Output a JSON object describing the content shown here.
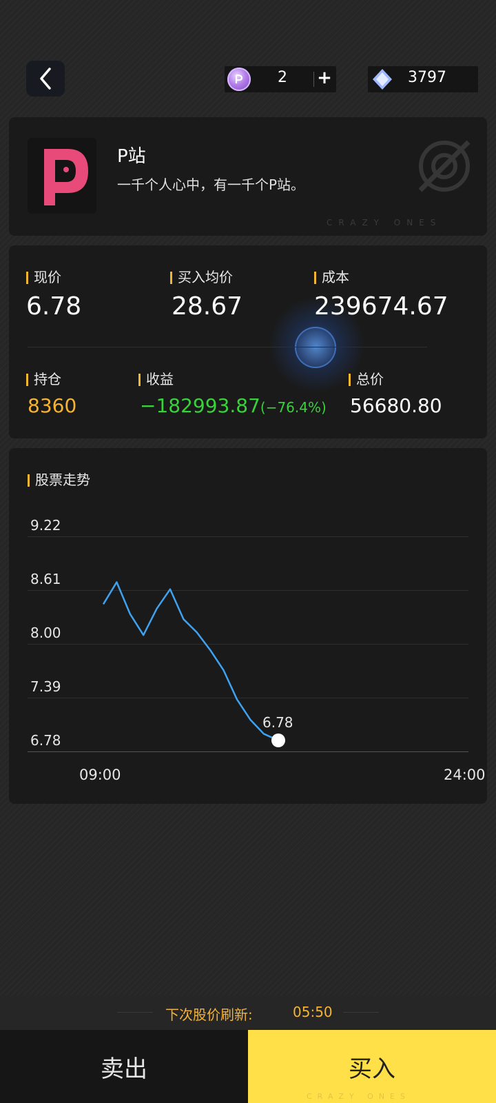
{
  "header": {
    "coin_count": "2",
    "plus_label": "+",
    "gem_count": "3797"
  },
  "company": {
    "name": "P站",
    "slogan": "一千个人心中，有一千个P站。",
    "watermark": "CRAZY ONES",
    "logo_color": "#e84a7a"
  },
  "stats": {
    "current_price_label": "现价",
    "current_price": "6.78",
    "avg_buy_label": "买入均价",
    "avg_buy": "28.67",
    "cost_label": "成本",
    "cost": "239674.67",
    "holdings_label": "持仓",
    "holdings": "8360",
    "profit_label": "收益",
    "profit": "−182993.87",
    "profit_pct": "(−76.4%)",
    "total_label": "总价",
    "total": "56680.80"
  },
  "chart_section": {
    "title": "股票走势"
  },
  "chart_data": {
    "type": "line",
    "x_labels": [
      "09:00",
      "24:00"
    ],
    "y_ticks": [
      "9.22",
      "8.61",
      "8.00",
      "7.39",
      "6.78"
    ],
    "ylim": [
      6.78,
      9.22
    ],
    "series": [
      {
        "values": [
          8.45,
          8.7,
          8.34,
          8.1,
          8.4,
          8.62,
          8.28,
          8.13,
          7.93,
          7.7,
          7.37,
          7.14,
          6.98,
          6.78
        ]
      }
    ],
    "last_value_label": "6.78",
    "line_color": "#3fa2f0"
  },
  "footer": {
    "refresh_label": "下次股价刷新:",
    "refresh_time": "05:50",
    "sell_label": "卖出",
    "buy_label": "买入",
    "buy_watermark": "CRAZY ONES"
  }
}
